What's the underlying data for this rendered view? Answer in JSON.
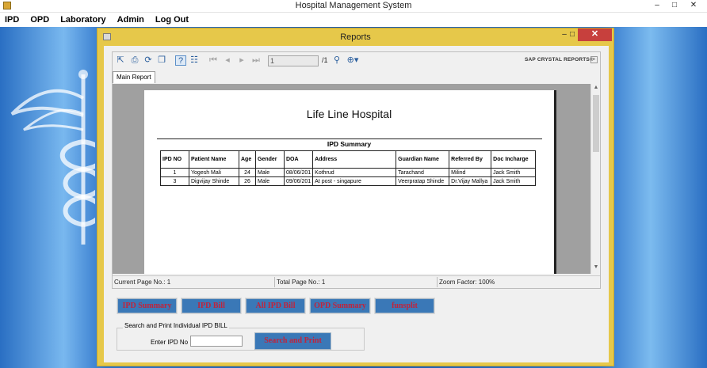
{
  "window": {
    "title": "Hospital Management System",
    "controls": {
      "minimize": "–",
      "maximize": "□",
      "close": "✕"
    }
  },
  "menu": [
    "IPD",
    "OPD",
    "Laboratory",
    "Admin",
    "Log Out"
  ],
  "dialog": {
    "title": "Reports",
    "controls": {
      "minimize": "–",
      "maximize": "□",
      "close": "✕"
    }
  },
  "viewer": {
    "page_input": "1",
    "page_total": "/1",
    "brand": "SAP CRYSTAL REPORTS®",
    "tab": "Main Report",
    "status": {
      "current_page": "Current Page No.: 1",
      "total_page": "Total Page No.: 1",
      "zoom": "Zoom Factor: 100%"
    },
    "toolbar_icons": [
      "export-icon",
      "print-icon",
      "refresh-icon",
      "copy-icon",
      "help-icon",
      "group-tree-icon",
      "first-page-icon",
      "previous-page-icon",
      "next-page-icon",
      "last-page-icon",
      "find-icon",
      "zoom-icon"
    ]
  },
  "report": {
    "hospital": "Life Line Hospital",
    "summary_title": "IPD Summary",
    "columns": [
      "IPD NO",
      "Patient Name",
      "Age",
      "Gender",
      "DOA",
      "Address",
      "Guardian Name",
      "Referred By",
      "Doc Incharge"
    ],
    "rows": [
      [
        "1",
        "Yogesh Mali",
        "24",
        "Male",
        "08/06/201",
        "Kothrud",
        "Tarachand",
        "Milind",
        "Jack Smith"
      ],
      [
        "3",
        "Digvijay Shinde",
        "26",
        "Male",
        "09/06/201",
        "At post - singapure",
        "Veerpratap Shinde",
        "Dr.Vijay Mallya",
        "Jack Smith"
      ]
    ]
  },
  "actions": [
    "IPD Summary",
    "IPD Bill",
    "All IPD Bill",
    "OPD Summary",
    "funsplit"
  ],
  "search": {
    "legend": "Search and Print Individual IPD BILL",
    "label": "Enter IPD No",
    "value": "",
    "button": "Search and Print"
  },
  "colors": {
    "accent_button": "#3a78b7",
    "button_text": "#c0243c",
    "dialog_border": "#e6c84a"
  }
}
